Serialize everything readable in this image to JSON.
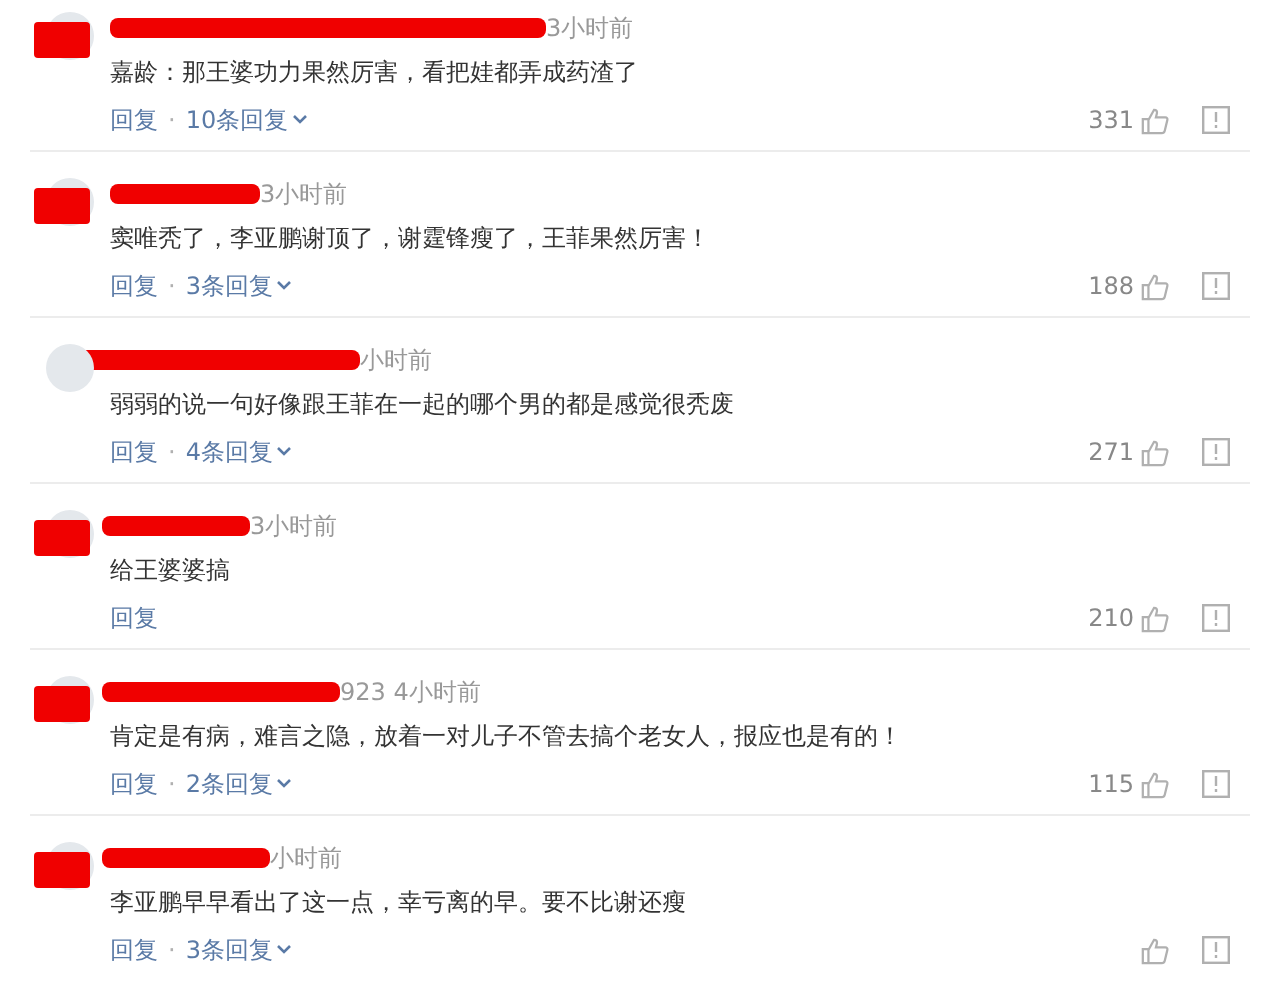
{
  "comments": [
    {
      "time": "3小时前",
      "text": "嘉龄：那王婆功力果然厉害，看把娃都弄成药渣了",
      "reply": "回复",
      "sep": "·",
      "replies": "10条回复",
      "likes": "331"
    },
    {
      "time": "3小时前",
      "text": "窦唯秃了，李亚鹏谢顶了，谢霆锋瘦了，王菲果然厉害！",
      "reply": "回复",
      "sep": "·",
      "replies": "3条回复",
      "likes": "188"
    },
    {
      "time": "小时前",
      "text": "弱弱的说一句好像跟王菲在一起的哪个男的都是感觉很秃废",
      "reply": "回复",
      "sep": "·",
      "replies": "4条回复",
      "likes": "271"
    },
    {
      "time": "3小时前",
      "text": "给王婆婆搞",
      "reply": "回复",
      "likes": "210"
    },
    {
      "time": "923 4小时前",
      "text": "肯定是有病，难言之隐，放着一对儿子不管去搞个老女人，报应也是有的！",
      "reply": "回复",
      "sep": "·",
      "replies": "2条回复",
      "likes": "115"
    },
    {
      "time": "小时前",
      "text": "李亚鹏早早看出了这一点，幸亏离的早。要不比谢还瘦",
      "reply": "回复",
      "sep": "·",
      "replies": "3条回复"
    }
  ]
}
